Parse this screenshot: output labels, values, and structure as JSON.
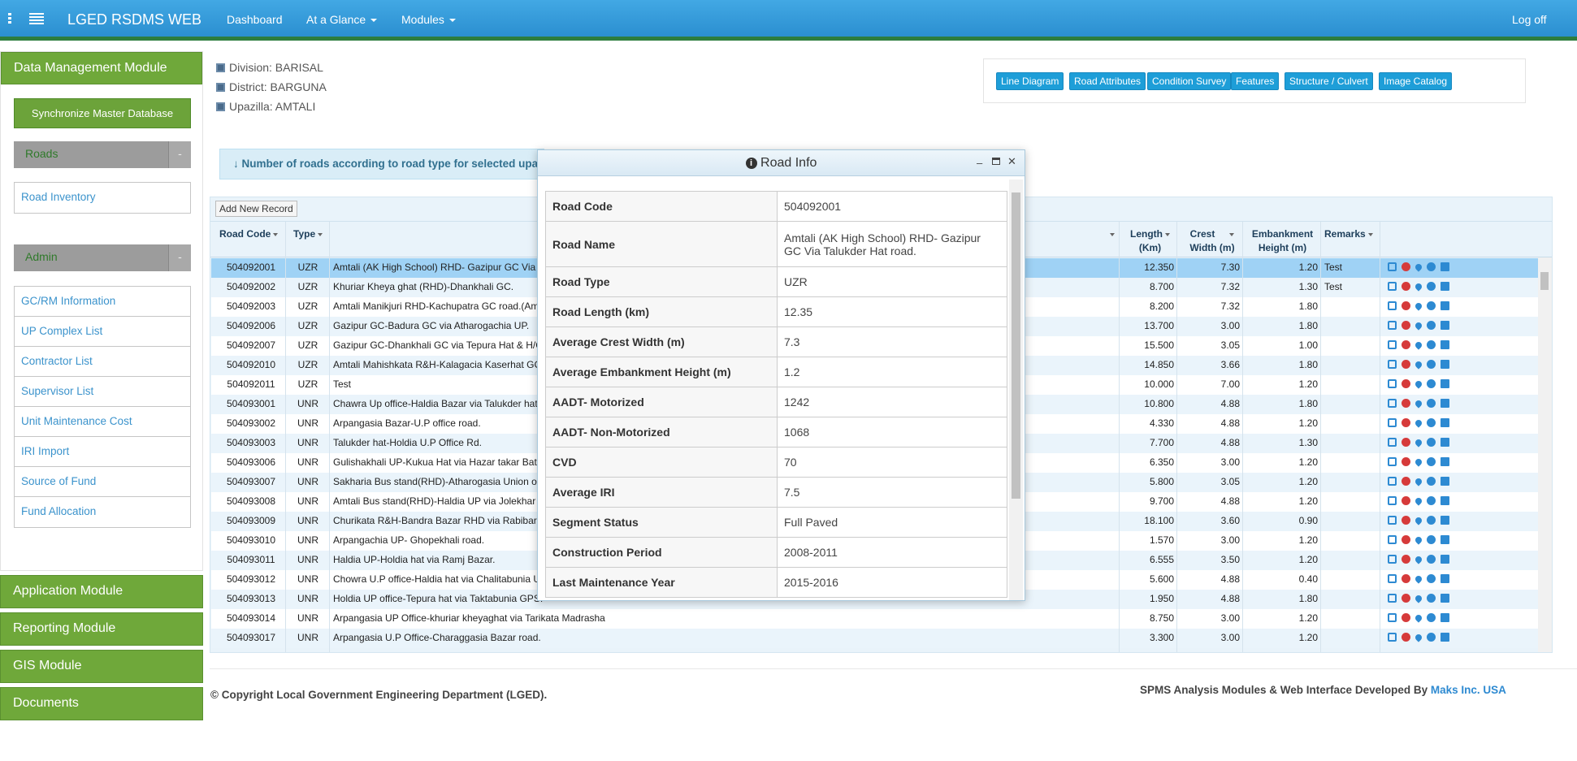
{
  "app": {
    "title": "LGED RSDMS WEB"
  },
  "nav": {
    "dashboard": "Dashboard",
    "glance": "At a Glance",
    "modules": "Modules",
    "logoff": "Log off"
  },
  "sidebar": {
    "header": "Data Management Module",
    "sync_button": "Synchronize Master Database",
    "roads_section": "Roads",
    "roads_toggle": "-",
    "roads_items": [
      "Road Inventory"
    ],
    "admin_section": "Admin",
    "admin_toggle": "-",
    "admin_items": [
      "GC/RM Information",
      "UP Complex List",
      "Contractor List",
      "Supervisor List",
      "Unit Maintenance Cost",
      "IRI Import",
      "Source of Fund",
      "Fund Allocation"
    ],
    "modules": [
      "Application Module",
      "Reporting Module",
      "GIS Module",
      "Documents"
    ]
  },
  "location": {
    "division": "Division: BARISAL",
    "district": "District: BARGUNA",
    "upazilla": "Upazilla: AMTALI"
  },
  "toolbar": [
    "Line Diagram",
    "Road Attributes",
    "Condition Survey",
    "Features",
    "Structure / Culvert",
    "Image Catalog"
  ],
  "info_bar": "Number of roads according to road type for selected upaz",
  "grid": {
    "add_button": "Add New Record",
    "headers": {
      "code": "Road Code",
      "type": "Type",
      "length1": "Length",
      "length2": "(Km)",
      "crest1": "Crest",
      "crest2": "Width (m)",
      "emb1": "Embankment",
      "emb2": "Height (m)",
      "remarks": "Remarks"
    },
    "rows": [
      [
        "504092001",
        "UZR",
        "Amtali (AK High School) RHD- Gazipur GC Via",
        "12.350",
        "7.30",
        "1.20",
        "Test"
      ],
      [
        "504092002",
        "UZR",
        "Khuriar Kheya ghat (RHD)-Dhankhali GC.",
        "8.700",
        "7.32",
        "1.30",
        "Test"
      ],
      [
        "504092003",
        "UZR",
        "Amtali Manikjuri RHD-Kachupatra GC road.(Am",
        "8.200",
        "7.32",
        "1.80",
        ""
      ],
      [
        "504092006",
        "UZR",
        "Gazipur GC-Badura GC via Atharogachia UP.",
        "13.700",
        "3.00",
        "1.80",
        ""
      ],
      [
        "504092007",
        "UZR",
        "Gazipur GC-Dhankhali GC via Tepura Hat & H/C",
        "15.500",
        "3.05",
        "1.00",
        ""
      ],
      [
        "504092010",
        "UZR",
        "Amtali Mahishkata R&H-Kalagacia Kaserhat GC",
        "14.850",
        "3.66",
        "1.80",
        ""
      ],
      [
        "504092011",
        "UZR",
        "Test",
        "10.000",
        "7.00",
        "1.20",
        ""
      ],
      [
        "504093001",
        "UNR",
        "Chawra Up office-Haldia Bazar via Talukder hat",
        "10.800",
        "4.88",
        "1.80",
        ""
      ],
      [
        "504093002",
        "UNR",
        "Arpangasia Bazar-U.P office road.",
        "4.330",
        "4.88",
        "1.20",
        ""
      ],
      [
        "504093003",
        "UNR",
        "Talukder hat-Holdia U.P Office Rd.",
        "7.700",
        "4.88",
        "1.30",
        ""
      ],
      [
        "504093006",
        "UNR",
        "Gulishakhali UP-Kukua Hat via Hazar takar Bat",
        "6.350",
        "3.00",
        "1.20",
        ""
      ],
      [
        "504093007",
        "UNR",
        "Sakharia Bus stand(RHD)-Atharogasia Union o",
        "5.800",
        "3.05",
        "1.20",
        ""
      ],
      [
        "504093008",
        "UNR",
        "Amtali Bus stand(RHD)-Haldia UP via Jolekhar",
        "9.700",
        "4.88",
        "1.20",
        ""
      ],
      [
        "504093009",
        "UNR",
        "Churikata R&H-Bandra Bazar RHD via Rabibar",
        "18.100",
        "3.60",
        "0.90",
        ""
      ],
      [
        "504093010",
        "UNR",
        "Arpangachia UP- Ghopekhali road.",
        "1.570",
        "3.00",
        "1.20",
        ""
      ],
      [
        "504093011",
        "UNR",
        "Haldia UP-Holdia hat via Ramj Bazar.",
        "6.555",
        "3.50",
        "1.20",
        ""
      ],
      [
        "504093012",
        "UNR",
        "Chowra U.P office-Haldia hat via Chalitabunia U",
        "5.600",
        "4.88",
        "0.40",
        ""
      ],
      [
        "504093013",
        "UNR",
        "Holdia UP office-Tepura hat via Taktabunia GPS.",
        "1.950",
        "4.88",
        "1.80",
        ""
      ],
      [
        "504093014",
        "UNR",
        "Arpangasia UP Office-khuriar kheyaghat via Tarikata Madrasha",
        "8.750",
        "3.00",
        "1.20",
        ""
      ],
      [
        "504093017",
        "UNR",
        "Arpangasia U.P Office-Charaggasia Bazar road.",
        "3.300",
        "3.00",
        "1.20",
        ""
      ]
    ]
  },
  "modal": {
    "title": "Road Info",
    "fields": [
      [
        "Road Code",
        "504092001"
      ],
      [
        "Road Name",
        "Amtali (AK High School) RHD- Gazipur GC Via Talukder Hat road."
      ],
      [
        "Road Type",
        "UZR"
      ],
      [
        "Road Length (km)",
        "12.35"
      ],
      [
        "Average Crest Width (m)",
        "7.3"
      ],
      [
        "Average Embankment Height (m)",
        "1.2"
      ],
      [
        "AADT- Motorized",
        "1242"
      ],
      [
        "AADT- Non-Motorized",
        "1068"
      ],
      [
        "CVD",
        "70"
      ],
      [
        "Average IRI",
        "7.5"
      ],
      [
        "Segment Status",
        "Full Paved"
      ],
      [
        "Construction Period",
        "2008-2011"
      ],
      [
        "Last Maintenance Year",
        "2015-2016"
      ]
    ]
  },
  "footer": {
    "copyright": "© Copyright Local Government Engineering Department (LGED).",
    "dev_text": "SPMS Analysis Modules & Web Interface Developed By ",
    "dev_link": "Maks Inc. USA"
  },
  "colors": {
    "accent": "#2b8fd0",
    "module_green": "#6fa83a",
    "selected_row": "#9fd2f5"
  }
}
